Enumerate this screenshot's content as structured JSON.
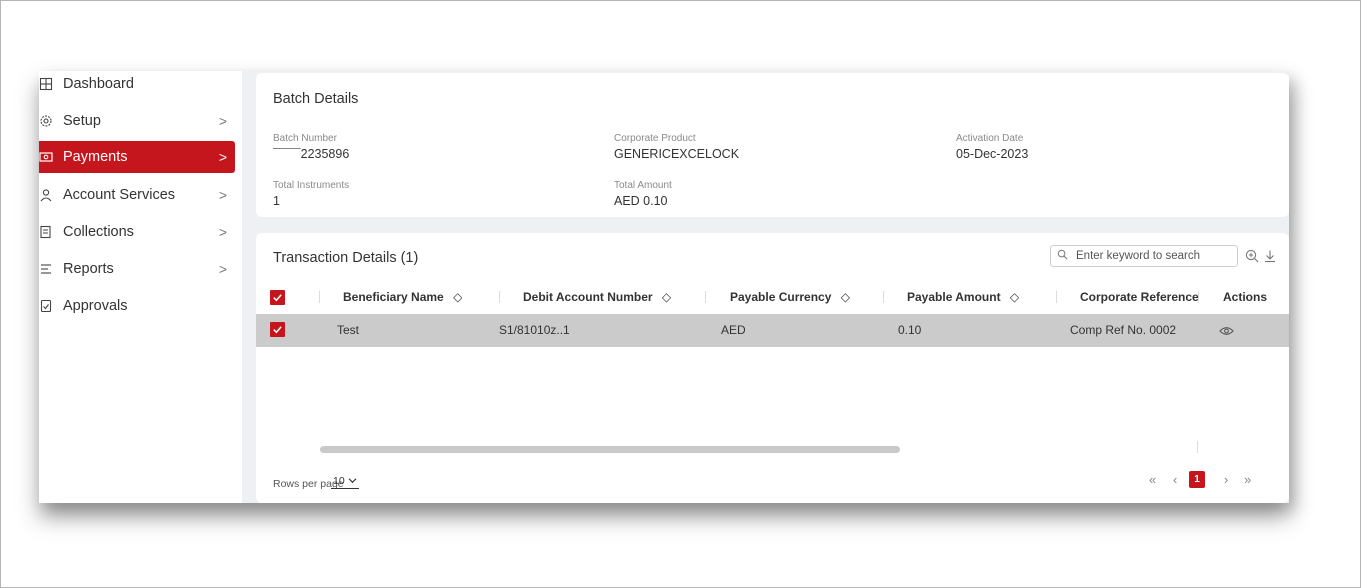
{
  "sidebar": {
    "items": [
      {
        "label": "Dashboard",
        "icon": "dashboard-icon",
        "has_chevron": false,
        "active": false
      },
      {
        "label": "Setup",
        "icon": "gear-icon",
        "has_chevron": true,
        "active": false
      },
      {
        "label": "Payments",
        "icon": "payments-icon",
        "has_chevron": true,
        "active": true
      },
      {
        "label": "Account Services",
        "icon": "user-icon",
        "has_chevron": true,
        "active": false
      },
      {
        "label": "Collections",
        "icon": "collections-icon",
        "has_chevron": true,
        "active": false
      },
      {
        "label": "Reports",
        "icon": "reports-icon",
        "has_chevron": true,
        "active": false
      },
      {
        "label": "Approvals",
        "icon": "approvals-icon",
        "has_chevron": false,
        "active": false
      }
    ],
    "chevron": ">"
  },
  "batch": {
    "title": "Batch Details",
    "fields": {
      "batch_number": {
        "label": "Batch Number",
        "value": "¯¯¯¯2235896"
      },
      "corporate_product": {
        "label": "Corporate Product",
        "value": "GENERICEXCELOCK"
      },
      "activation_date": {
        "label": "Activation Date",
        "value": "05-Dec-2023"
      },
      "total_instruments": {
        "label": "Total Instruments",
        "value": "1"
      },
      "total_amount": {
        "label": "Total Amount",
        "value": "AED 0.10"
      }
    }
  },
  "transactions": {
    "title": "Transaction Details (1)",
    "search_placeholder": "Enter keyword to search",
    "columns": [
      "Beneficiary Name",
      "Debit Account Number",
      "Payable Currency",
      "Payable Amount",
      "Corporate Reference N",
      "Actions"
    ],
    "sort_glyph": "◇",
    "rows": [
      {
        "beneficiary_name": "Test",
        "debit_account_number": "S1/81010z..1",
        "payable_currency": "AED",
        "payable_amount": "0.10",
        "corporate_reference": "Comp Ref No. 0002"
      }
    ],
    "rows_per_page_label": "Rows per page",
    "rows_per_page_value": "10",
    "pagination": {
      "first": "«",
      "prev": "‹",
      "current": "1",
      "next": "›",
      "last": "»"
    }
  },
  "colors": {
    "accent": "#c4161c",
    "selected_row": "#cbcbcb",
    "background": "#eef0f3"
  }
}
